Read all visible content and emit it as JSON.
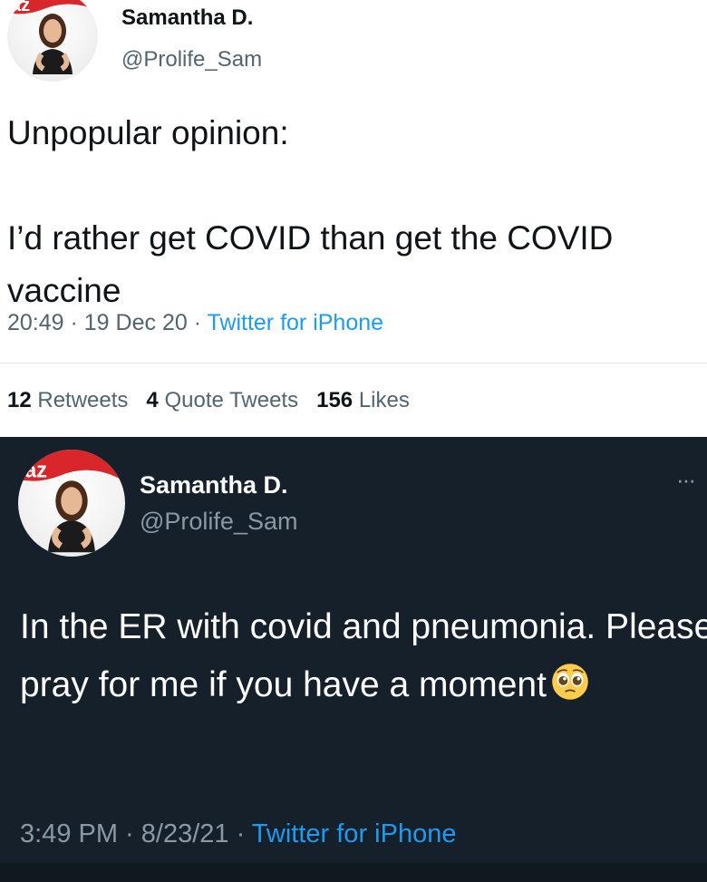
{
  "tweet_top": {
    "avatar_overlay_text": "az",
    "display_name": "Samantha D.",
    "handle": "@Prolife_Sam",
    "text": "Unpopular opinion:\n\nI’d rather get COVID than get the COVID vaccine",
    "time": "20:49",
    "date": "19 Dec 20",
    "separator": " · ",
    "source": "Twitter for iPhone",
    "stats": {
      "retweets_count": "12",
      "retweets_label": "Retweets",
      "quotes_count": "4",
      "quotes_label": "Quote Tweets",
      "likes_count": "156",
      "likes_label": "Likes"
    }
  },
  "tweet_bottom": {
    "avatar_overlay_text": "az",
    "display_name": "Samantha D.",
    "handle": "@Prolife_Sam",
    "more_label": "···",
    "text": "In the ER with covid and pneumonia. Please pray for me if you have a moment",
    "emoji": "pleading-face-emoji",
    "time": "3:49 PM",
    "date": "8/23/21",
    "separator": " · ",
    "source": "Twitter for iPhone"
  },
  "colors": {
    "light_bg": "#ffffff",
    "dark_bg": "#15202b",
    "link_blue": "#1d9bf0",
    "brand_red": "#d9262b"
  }
}
